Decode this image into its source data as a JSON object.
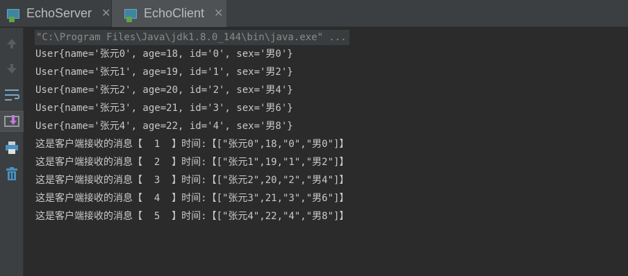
{
  "tabs": [
    {
      "label": "EchoServer",
      "icon": "java-app-icon",
      "active": false
    },
    {
      "label": "EchoClient",
      "icon": "java-app-icon",
      "active": true
    }
  ],
  "tab_close_glyph": "✕",
  "toolbar": {
    "icons": [
      "up-arrow-icon",
      "down-arrow-icon",
      "soft-wrap-icon",
      "scroll-to-end-icon",
      "print-icon",
      "trash-icon"
    ]
  },
  "console": {
    "command": "\"C:\\Program Files\\Java\\jdk1.8.0_144\\bin\\java.exe\" ...",
    "lines": [
      "User{name='张元0', age=18, id='0', sex='男0'}",
      "User{name='张元1', age=19, id='1', sex='男2'}",
      "User{name='张元2', age=20, id='2', sex='男4'}",
      "User{name='张元3', age=21, id='3', sex='男6'}",
      "User{name='张元4', age=22, id='4', sex='男8'}",
      "这是客户端接收的消息【  1  】时间:【[\"张元0\",18,\"0\",\"男0\"]】",
      "这是客户端接收的消息【  2  】时间:【[\"张元1\",19,\"1\",\"男2\"]】",
      "这是客户端接收的消息【  3  】时间:【[\"张元2\",20,\"2\",\"男4\"]】",
      "这是客户端接收的消息【  4  】时间:【[\"张元3\",21,\"3\",\"男6\"]】",
      "这是客户端接收的消息【  5  】时间:【[\"张元4\",22,\"4\",\"男8\"]】"
    ]
  },
  "colors": {
    "background": "#2b2b2b",
    "chrome": "#3c3f41",
    "output_text": "#c9c9c9",
    "command_text": "#8a8a8a"
  }
}
